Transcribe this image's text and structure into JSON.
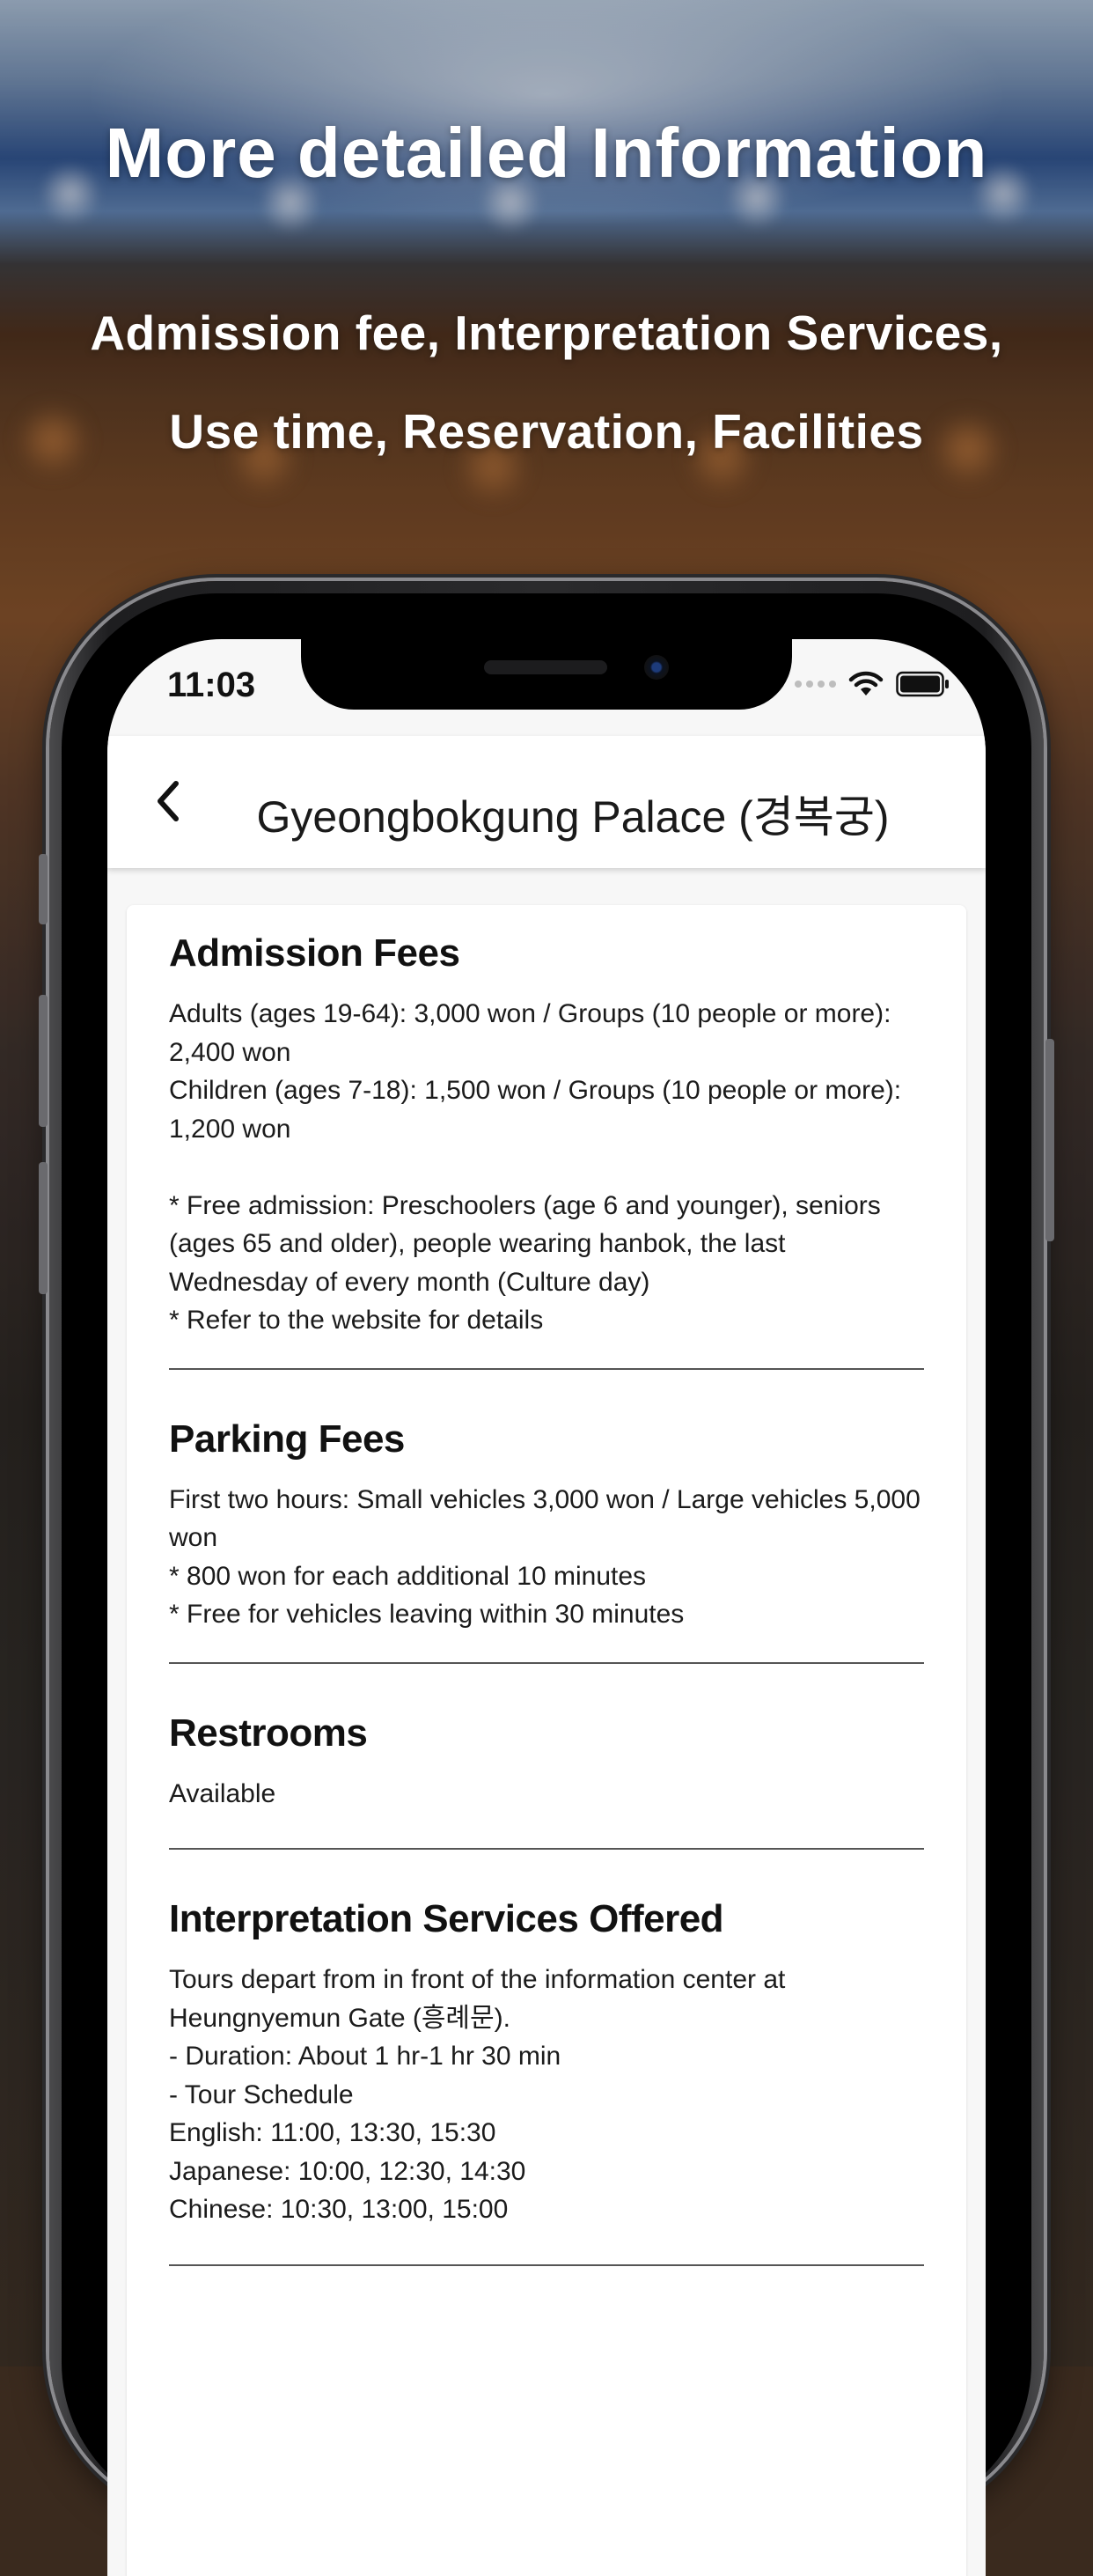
{
  "headline": "More detailed Information",
  "subline1": "Admission fee, Interpretation Services,",
  "subline2": "Use time, Reservation, Facilities",
  "status_bar": {
    "time": "11:03"
  },
  "nav": {
    "title": "Gyeongbokgung Palace (경복궁)"
  },
  "sections": [
    {
      "title": "Admission Fees",
      "body": "Adults (ages 19-64): 3,000 won / Groups (10 people or more):\n2,400 won\nChildren (ages 7-18): 1,500 won / Groups (10 people or more):\n1,200 won\n\n* Free admission: Preschoolers (age 6 and younger), seniors\n(ages 65 and older), people wearing hanbok, the last\nWednesday of every month (Culture day)\n* Refer to the website for details"
    },
    {
      "title": "Parking Fees",
      "body": "First two hours: Small vehicles 3,000 won / Large vehicles 5,000\nwon\n* 800 won for each additional 10 minutes\n* Free for vehicles leaving within 30 minutes"
    },
    {
      "title": "Restrooms",
      "body": "Available"
    },
    {
      "title": "Interpretation Services Offered",
      "body": "Tours depart from in front of the information center at\nHeungnyemun Gate (흥례문).\n- Duration: About 1 hr-1 hr 30 min\n- Tour Schedule\n English: 11:00, 13:30, 15:30\n Japanese: 10:00, 12:30, 14:30\n Chinese: 10:30, 13:00, 15:00"
    }
  ]
}
